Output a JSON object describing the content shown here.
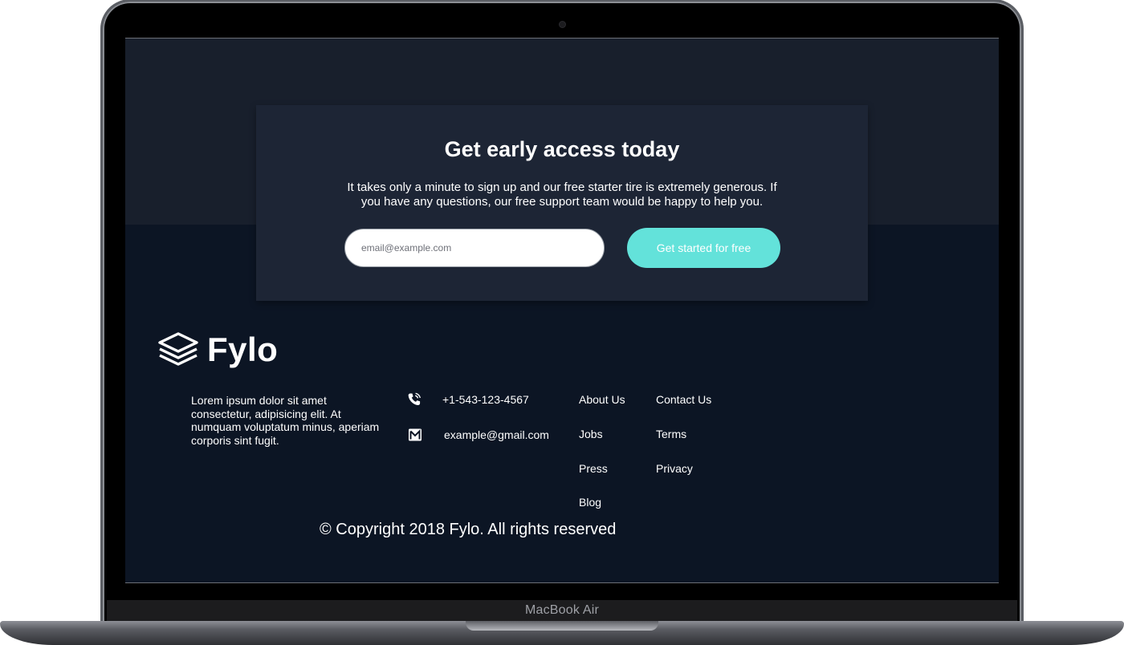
{
  "device": {
    "label": "MacBook Air"
  },
  "cta": {
    "title": "Get early access today",
    "text": "It takes only a minute to sign up and our free starter tire is extremely generous. If you have any questions, our free support team would be happy to help you.",
    "email_placeholder": "email@example.com",
    "button_label": "Get started for free",
    "accent_color": "#63e2da"
  },
  "footer": {
    "brand": "Fylo",
    "about": "Lorem ipsum dolor sit amet consectetur, adipisicing elit. At numquam voluptatum minus, aperiam corporis sint fugit.",
    "contact": {
      "phone": "+1-543-123-4567",
      "phone_icon": "phone-icon",
      "email": "example@gmail.com",
      "email_icon": "mail-icon"
    },
    "links_col1": [
      "About Us",
      "Jobs",
      "Press",
      "Blog"
    ],
    "links_col2": [
      "Contact Us",
      "Terms",
      "Privacy"
    ],
    "copyright": "© Copyright 2018 Fylo. All rights reserved"
  },
  "colors": {
    "page_background": "#0c1524",
    "top_band": "#181f2c",
    "card_background": "#1d2535"
  }
}
